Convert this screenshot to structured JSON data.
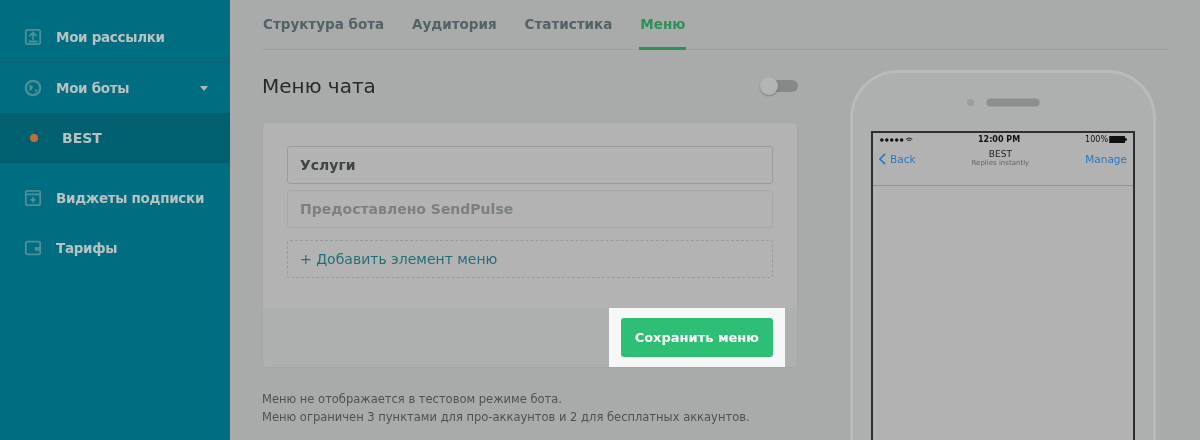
{
  "sidebar": {
    "items": [
      {
        "label": "Мои рассылки"
      },
      {
        "label": "Мои боты",
        "expanded": true,
        "children": [
          {
            "label": "BEST",
            "selected": true,
            "color": "#c0703a"
          }
        ]
      },
      {
        "label": "Виджеты подписки"
      },
      {
        "label": "Тарифы"
      }
    ]
  },
  "tabs": [
    {
      "label": "Структура бота",
      "selected": false
    },
    {
      "label": "Аудитория",
      "selected": false
    },
    {
      "label": "Статистика",
      "selected": false
    },
    {
      "label": "Меню",
      "selected": true
    }
  ],
  "menu_editor": {
    "title": "Меню чата",
    "on": false,
    "items": [
      {
        "value": "Услуги",
        "disabled": false
      },
      {
        "value": "Предоставлено SendPulse",
        "disabled": true
      }
    ],
    "add_link": "+ Добавить элемент меню",
    "save_button": "Сохранить меню"
  },
  "notes": [
    "Меню не отображается в тестовом режиме бота.",
    "Меню ограничен 3 пунктами для про-аккаунтов и 2 для бесплатных аккаунтов."
  ],
  "phone_preview": {
    "time": "12:00 PM",
    "battery": "100%",
    "back": "Back",
    "title": "BEST",
    "subtitle": "Replies instantly",
    "action": "Manage"
  }
}
